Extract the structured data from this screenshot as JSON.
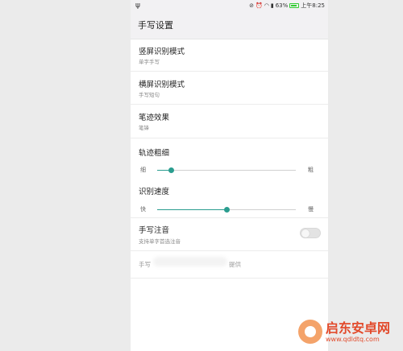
{
  "statusbar": {
    "usb_icon": "usb-icon",
    "battery_percent": "63%",
    "time": "上午8:25"
  },
  "header": {
    "title": "手写设置"
  },
  "settings": {
    "vertical_mode": {
      "title": "竖屏识别模式",
      "value": "单字手写"
    },
    "horizontal_mode": {
      "title": "横屏识别模式",
      "value": "手写短句"
    },
    "stroke_effect": {
      "title": "笔迹效果",
      "value": "笔锋"
    },
    "stroke_width": {
      "title": "轨迹粗细",
      "min_label": "细",
      "max_label": "粗",
      "level": 0.1
    },
    "recognition_speed": {
      "title": "识别速度",
      "min_label": "快",
      "max_label": "慢",
      "level": 0.5
    },
    "pinyin": {
      "title": "手写注音",
      "desc": "支持单字首选注音",
      "enabled": false
    },
    "provider": {
      "prefix": "手写",
      "suffix": "提供"
    }
  },
  "watermark": {
    "brand": "启东安卓网",
    "url": "www.qdldtq.com"
  },
  "colors": {
    "accent": "#2a9d8f",
    "header_bg": "#f2f1f3"
  }
}
